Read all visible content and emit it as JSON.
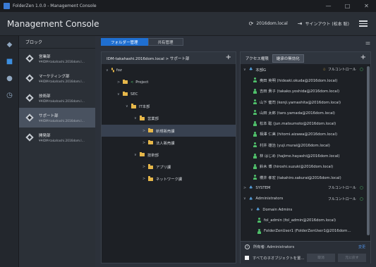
{
  "window": {
    "title": "FolderZen 1.0.0 - Management Console",
    "minimize": "—",
    "maximize": "□",
    "close": "✕"
  },
  "header": {
    "title": "Management Console",
    "domain": "2016dom.local",
    "signout": "サインアウト (松本 聡)"
  },
  "block": {
    "heading": "ブロック",
    "items": [
      {
        "name": "営業部",
        "server": "¥¥IDM-takahashi.2016dom.l…"
      },
      {
        "name": "マーケティング部",
        "server": "¥¥IDM-takahashi.2016dom.l…"
      },
      {
        "name": "技術部",
        "server": "¥¥IDM-takahashi.2016dom.l…"
      },
      {
        "name": "サポート部",
        "server": "¥¥IDM-takahashi.2016dom.l…"
      },
      {
        "name": "開発部",
        "server": "¥¥IDM-takahashi.2016dom.l…"
      }
    ],
    "selected_index": 3
  },
  "tabs": {
    "folder_mgmt": "フォルダー管理",
    "share_mgmt": "共有管理"
  },
  "left_panel": {
    "path": "IDM-takahashi.2016dom.local > サポート部",
    "nodes": [
      {
        "label": "foz",
        "chevron": "∨"
      },
      {
        "label": "Project",
        "chevron": ">"
      },
      {
        "label": "SEC",
        "chevron": "∨"
      },
      {
        "label": "IT本部",
        "chevron": "∨"
      },
      {
        "label": "営業部",
        "chevron": "∨"
      },
      {
        "label": "新規販売課",
        "chevron": ">"
      },
      {
        "label": "法人販売課",
        "chevron": ">"
      },
      {
        "label": "技術部",
        "chevron": "∨"
      },
      {
        "label": "アプリ課",
        "chevron": ">"
      },
      {
        "label": "ネットワーク課",
        "chevron": ">"
      }
    ]
  },
  "right_panel": {
    "tab_access": "アクセス権限",
    "tab_disable_inherit": "継承の無効化",
    "entries": [
      {
        "label": "本部G",
        "chevron": "∨",
        "right": "フルコントロール"
      },
      {
        "label": "奥田 英明 (hideaki.okuda@2016dom.local)"
      },
      {
        "label": "吉田 貴子 (takako.yoshida@2016dom.local)"
      },
      {
        "label": "山下 健司 (kenji.yamashita@2016dom.local)"
      },
      {
        "label": "山田 太郎 (taro.yamada@2016dom.local)"
      },
      {
        "label": "松本 聡 (jun.matsumoto@2016dom.local)"
      },
      {
        "label": "相澤 仁美 (hitomi.aizawa@2016dom.local)"
      },
      {
        "label": "村井 雄治 (yuji.murai@2016dom.local)"
      },
      {
        "label": "林 はじめ (hajime.hayashi@2016dom.local)"
      },
      {
        "label": "鈴木 博 (hiroshi.suzuki@2016dom.local)"
      },
      {
        "label": "櫻井 孝宏 (takahiro.sakurai@2016dom.local)"
      },
      {
        "label": "SYSTEM",
        "chevron": ">",
        "right": "フルコントロール"
      },
      {
        "label": "Administrators",
        "chevron": "∨",
        "right": "フルコントロール"
      },
      {
        "label": "Domain Admins",
        "chevron": "∨"
      },
      {
        "label": "fol_admin (fol_admin@2016dom.local)"
      },
      {
        "label": "FolderZenUser1 (FolderZenUser1@2016dom…"
      }
    ],
    "owner": "所有者: Administrators",
    "owner_change": "変更",
    "apply_children": "すべての子オブジェクトを置…",
    "btn_revert": "取消",
    "btn_apply": "元に戻す"
  }
}
